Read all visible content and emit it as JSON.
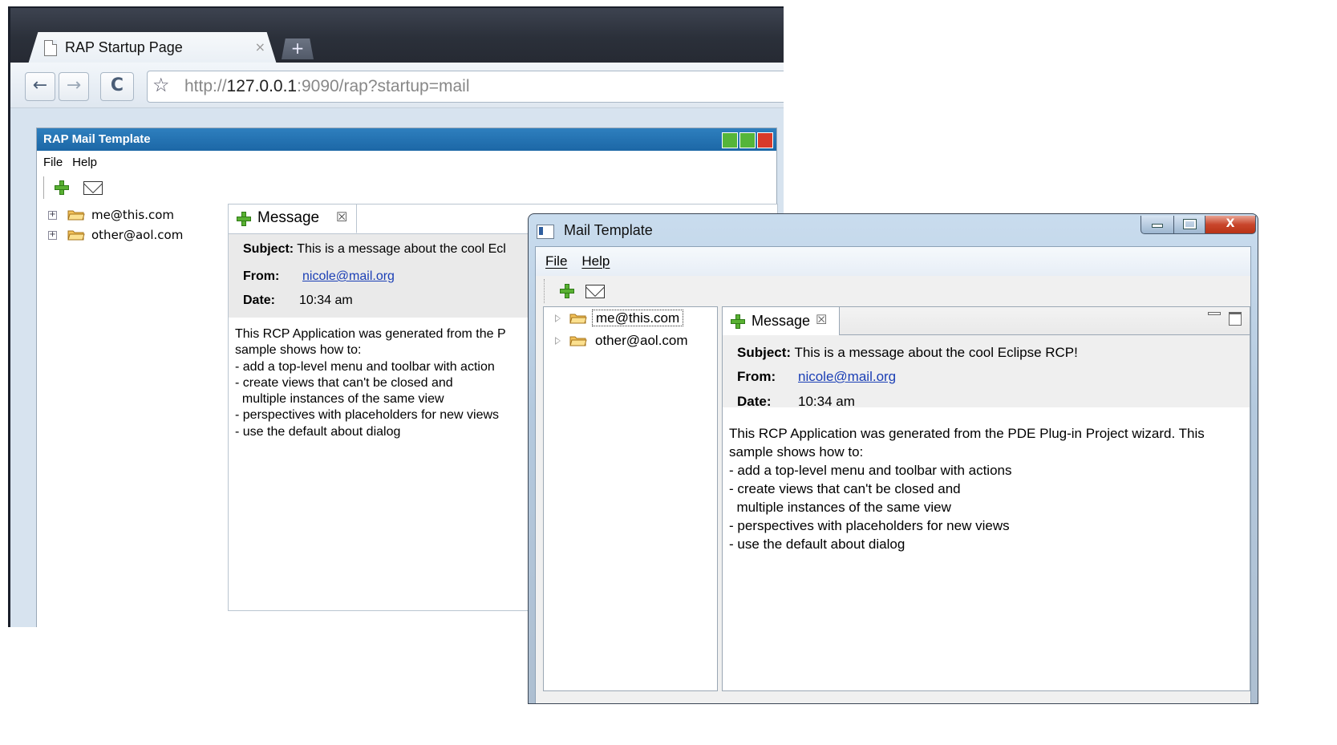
{
  "browser": {
    "tab_title": "RAP Startup Page",
    "tab_close": "×",
    "new_tab": "+",
    "back": "←",
    "forward": "→",
    "reload": "C",
    "star": "☆",
    "url_prefix": "http://",
    "url_host": "127.0.0.1",
    "url_rest": ":9090/rap?startup=mail"
  },
  "rap": {
    "title": "RAP Mail Template",
    "menu": [
      "File",
      "Help"
    ],
    "tree": [
      "me@this.com",
      "other@aol.com"
    ],
    "tab_label": "Message",
    "tab_close": "☒",
    "subject_label": "Subject:",
    "subject": "This is a message about the cool Ecl",
    "from_label": "From:",
    "from": "nicole@mail.org",
    "date_label": "Date:",
    "date": "10:34 am",
    "body": "This RCP Application was generated from the P\nsample shows how to:\n- add a top-level menu and toolbar with action\n- create views that can't be closed and\n  multiple instances of the same view\n- perspectives with placeholders for new views\n- use the default about dialog"
  },
  "native": {
    "title": "Mail Template",
    "caption_close": "X",
    "menu": [
      "File",
      "Help"
    ],
    "tree": [
      "me@this.com",
      "other@aol.com"
    ],
    "tab_label": "Message",
    "tab_close": "☒",
    "subject_label": "Subject:",
    "subject": "This is a message about the cool Eclipse RCP!",
    "from_label": "From:",
    "from": "nicole@mail.org",
    "date_label": "Date:",
    "date": "10:34 am",
    "body": "This RCP Application was generated from the PDE Plug-in Project wizard. This\nsample shows how to:\n- add a top-level menu and toolbar with actions\n- create views that can't be closed and\n  multiple instances of the same view\n- perspectives with placeholders for new views\n- use the default about dialog"
  },
  "icons": {
    "new": "plus-icon",
    "mail": "envelope-icon",
    "folder": "folder-icon"
  },
  "colors": {
    "rap_titlebar": "#1c67a6",
    "link": "#1b3fb5",
    "plus_green": "#59b132",
    "folder_yellow": "#f3c25a"
  }
}
